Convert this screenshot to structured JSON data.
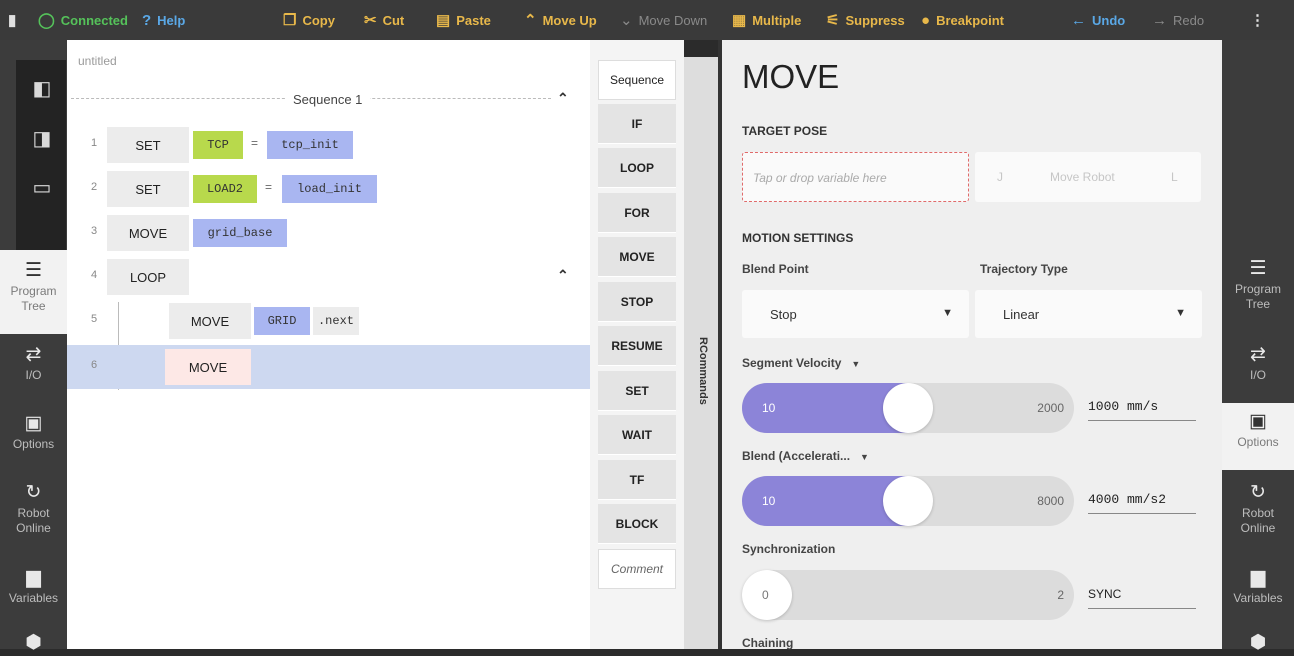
{
  "toolbar": {
    "status": "Connected",
    "help": "Help",
    "copy": "Copy",
    "cut": "Cut",
    "paste": "Paste",
    "move_up": "Move Up",
    "move_down": "Move Down",
    "multiple": "Multiple",
    "suppress": "Suppress",
    "breakpoint": "Breakpoint",
    "undo": "Undo",
    "redo": "Redo"
  },
  "left_nav": [
    {
      "label_1": "Program",
      "label_2": "Tree",
      "icon": "list-icon"
    },
    {
      "label_1": "I/O",
      "label_2": "",
      "icon": "arrows-icon"
    },
    {
      "label_1": "Options",
      "label_2": "",
      "icon": "clipboard-icon"
    },
    {
      "label_1": "Robot",
      "label_2": "Online",
      "icon": "robot-arm-icon"
    },
    {
      "label_1": "Variables",
      "label_2": "",
      "icon": "briefcase-icon"
    }
  ],
  "right_nav": [
    {
      "label_1": "Program",
      "label_2": "Tree"
    },
    {
      "label_1": "I/O",
      "label_2": ""
    },
    {
      "label_1": "Options",
      "label_2": ""
    },
    {
      "label_1": "Robot",
      "label_2": "Online"
    },
    {
      "label_1": "Variables",
      "label_2": ""
    }
  ],
  "program": {
    "file": "untitled",
    "sequence_title": "Sequence 1",
    "rows": [
      {
        "num": "1",
        "cmd": "SET",
        "var": "TCP",
        "eq": "=",
        "val": "tcp_init"
      },
      {
        "num": "2",
        "cmd": "SET",
        "var": "LOAD2",
        "eq": "=",
        "val": "load_init"
      },
      {
        "num": "3",
        "cmd": "MOVE",
        "val": "grid_base"
      },
      {
        "num": "4",
        "cmd": "LOOP"
      },
      {
        "num": "5",
        "cmd": "MOVE",
        "val": "GRID",
        "suffix": ".next"
      },
      {
        "num": "6",
        "cmd": "MOVE"
      }
    ]
  },
  "palette": [
    "Sequence",
    "IF",
    "LOOP",
    "FOR",
    "MOVE",
    "STOP",
    "RESUME",
    "SET",
    "WAIT",
    "TF",
    "BLOCK",
    "Comment"
  ],
  "palette_tab": "RCommands",
  "properties": {
    "title": "MOVE",
    "target_pose_heading": "TARGET POSE",
    "drop_placeholder": "Tap or drop variable here",
    "move_robot": "Move Robot",
    "move_robot_left": "J",
    "move_robot_right": "L",
    "motion_heading": "MOTION SETTINGS",
    "blend_point_label": "Blend Point",
    "blend_point_value": "Stop",
    "trajectory_label": "Trajectory Type",
    "trajectory_value": "Linear",
    "segment_velocity_label": "Segment Velocity",
    "velocity_min": "10",
    "velocity_max": "2000",
    "velocity_value": "1000 mm/s",
    "velocity_fraction": 0.5,
    "blend_label": "Blend (Accelerati...",
    "blend_min": "10",
    "blend_max": "8000",
    "blend_value": "4000 mm/s2",
    "blend_fraction": 0.5,
    "sync_label": "Synchronization",
    "sync_min": "0",
    "sync_max": "2",
    "sync_value": "SYNC",
    "sync_fraction": 0.0,
    "chaining_label": "Chaining"
  },
  "colors": {
    "accent_yellow": "#e8b84a",
    "connected_green": "#55c25a",
    "variable_green": "#b8d94c",
    "value_blue": "#a9b6f1",
    "slider_purple": "#8c84d8",
    "selected_row": "#cdd8f0"
  }
}
